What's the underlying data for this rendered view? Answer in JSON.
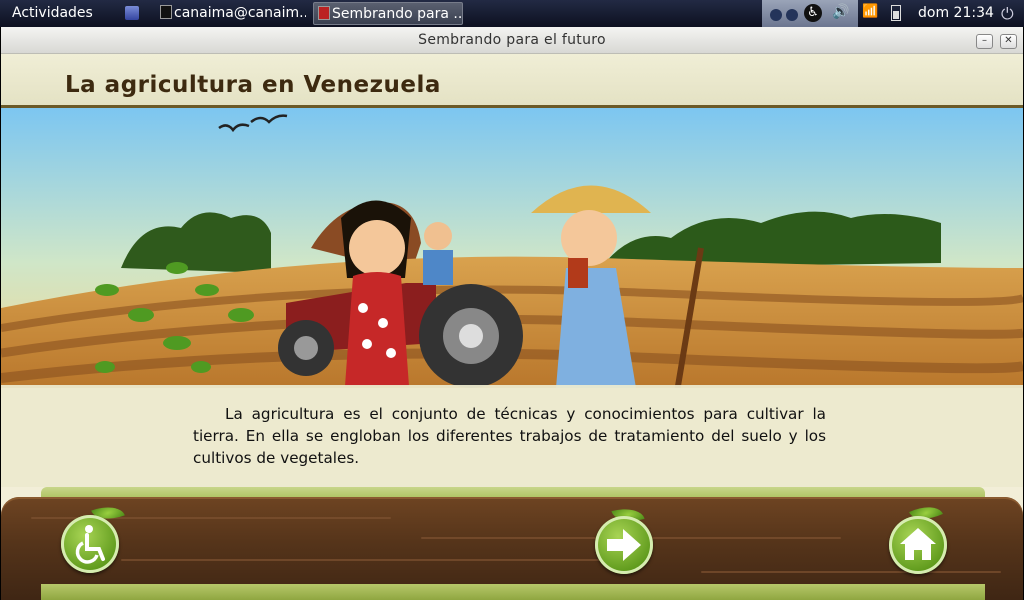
{
  "system_bar": {
    "activities": "Actividades",
    "tasks": [
      {
        "label": "canaima@canaim..."
      },
      {
        "label": "Sembrando para ..."
      }
    ],
    "clock": "dom 21:34"
  },
  "window": {
    "title": "Sembrando para el futuro",
    "minimize": "–",
    "close": "✕"
  },
  "page": {
    "heading": "La agricultura en Venezuela",
    "body": "La agricultura es el conjunto de técnicas y conocimientos para cultivar la tierra. En ella se engloban los diferentes trabajos de tratamiento del suelo y los cultivos de vegetales."
  },
  "nav": {
    "accessibility_icon": "wheelchair-icon",
    "next_icon": "arrow-right-icon",
    "home_icon": "home-icon"
  },
  "colors": {
    "heading": "#3d2a10",
    "sky": "#7fc8f0",
    "soil": "#c7893a",
    "wood": "#5a381c",
    "button_green": "#5f9a1c"
  }
}
